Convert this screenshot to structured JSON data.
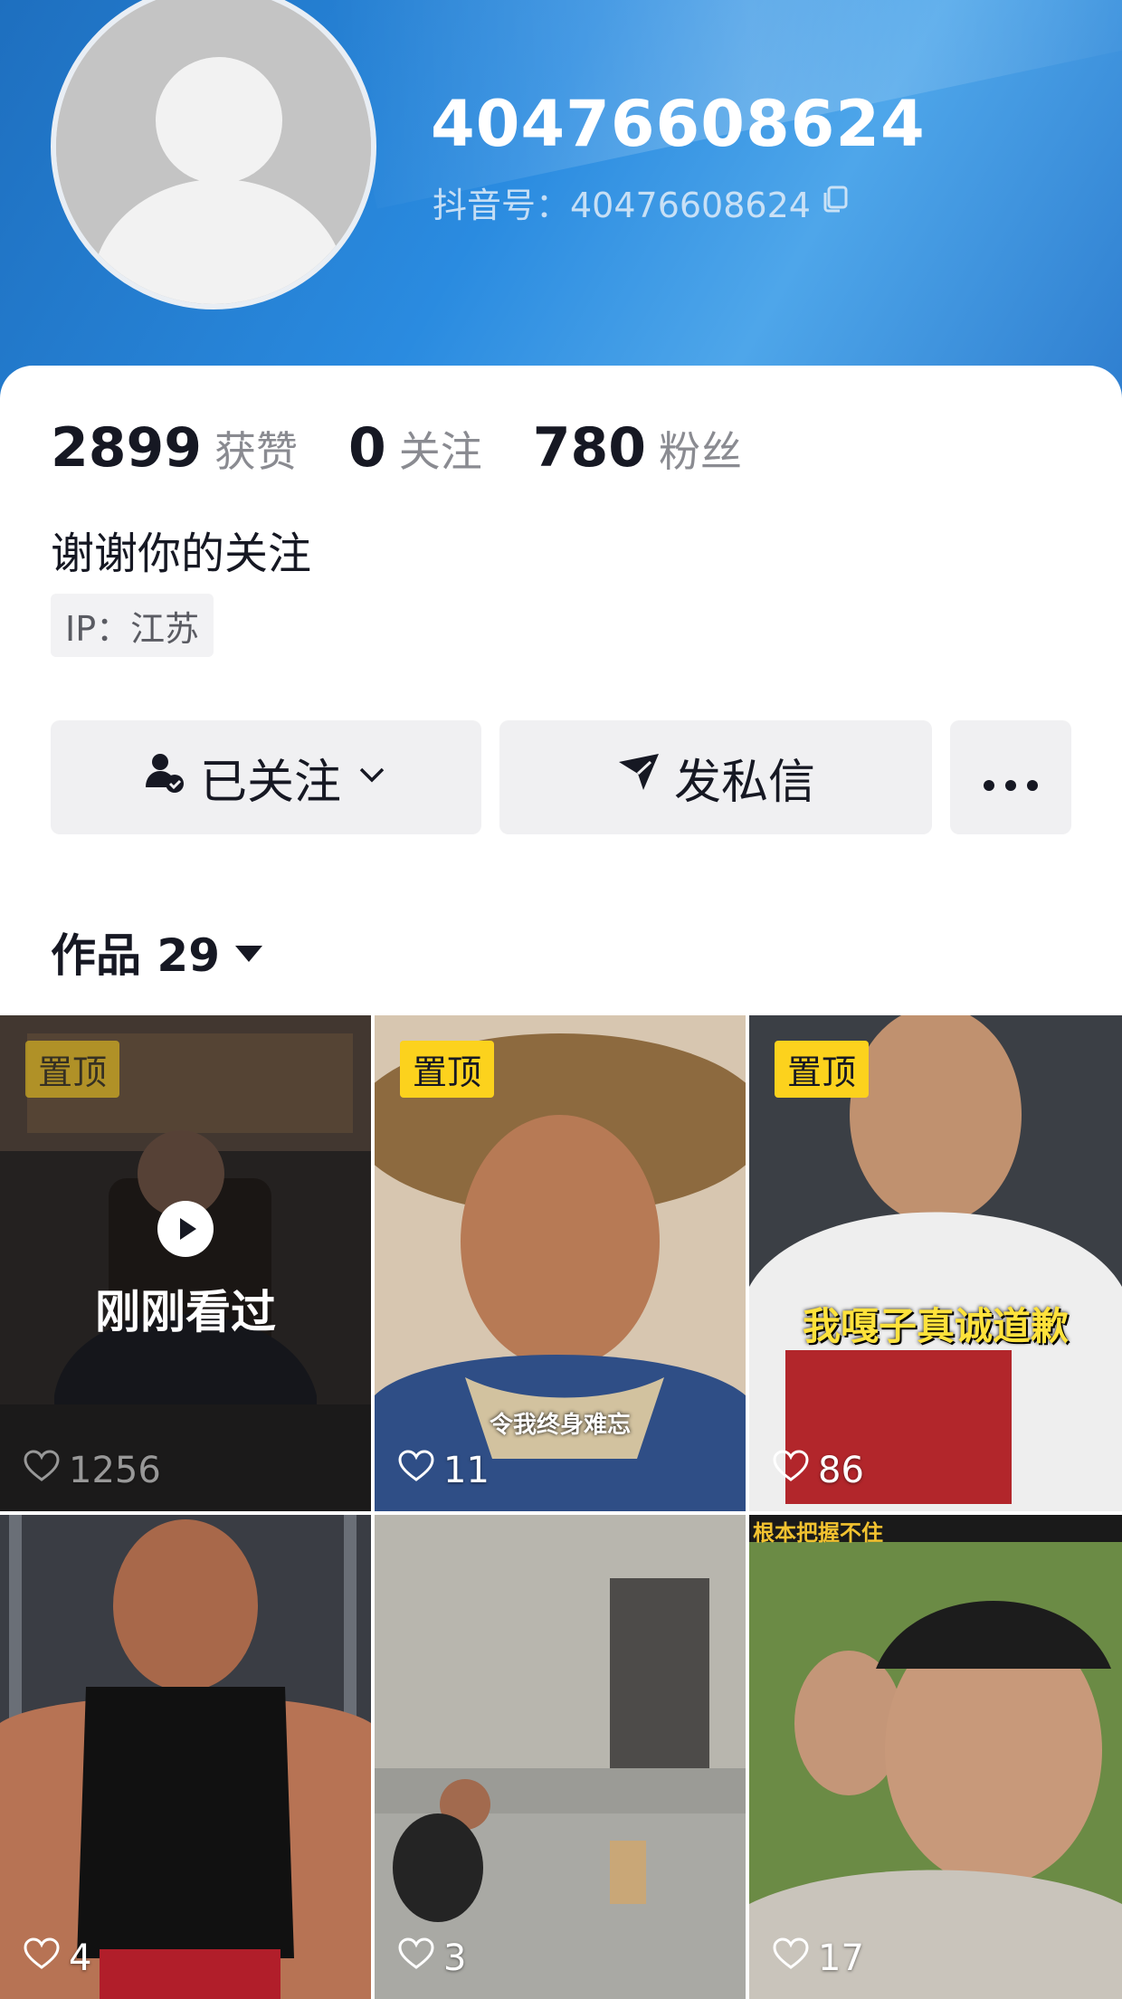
{
  "profile": {
    "username": "40476608624",
    "douyin_id_label": "抖音号：40476608624",
    "bio": "谢谢你的关注",
    "ip": "IP：江苏"
  },
  "stats": [
    {
      "value": "2899",
      "label": "获赞"
    },
    {
      "value": "0",
      "label": "关注"
    },
    {
      "value": "780",
      "label": "粉丝"
    }
  ],
  "actions": {
    "follow_label": "已关注",
    "message_label": "发私信"
  },
  "works": {
    "label": "作品 29"
  },
  "videos": [
    {
      "pinned": "置顶",
      "likes": "1256",
      "overlay": "刚刚看过",
      "caption": ""
    },
    {
      "pinned": "置顶",
      "likes": "11",
      "overlay": "",
      "caption": "令我终身难忘"
    },
    {
      "pinned": "置顶",
      "likes": "86",
      "overlay": "",
      "caption": "我嘎子真诚道歉"
    },
    {
      "pinned": "",
      "likes": "4",
      "overlay": "",
      "caption": ""
    },
    {
      "pinned": "",
      "likes": "3",
      "overlay": "",
      "caption": ""
    },
    {
      "pinned": "",
      "likes": "17",
      "overlay": "",
      "caption": "根本把握不住"
    }
  ],
  "colors": {
    "pin_badge": "#fcd21d",
    "header_blue": "#2a8be0",
    "text_primary": "#161823",
    "text_secondary": "#8a8b91"
  }
}
